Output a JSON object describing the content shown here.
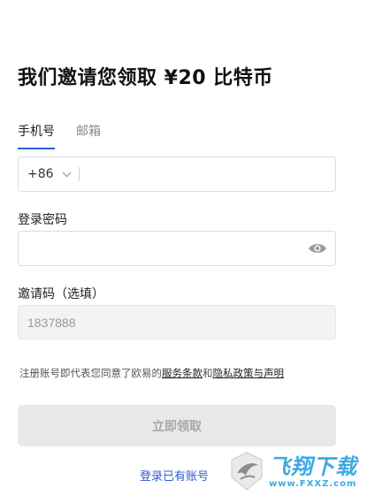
{
  "title": "我们邀请您领取 ¥20 比特币",
  "tabs": [
    {
      "label": "手机号",
      "active": true
    },
    {
      "label": "邮箱",
      "active": false
    }
  ],
  "phone": {
    "country_code": "+86",
    "value": "",
    "placeholder": ""
  },
  "password": {
    "label": "登录密码",
    "value": "",
    "placeholder": ""
  },
  "invite": {
    "label": "邀请码（选填）",
    "value": "1837888"
  },
  "terms": {
    "prefix": "注册账号即代表您同意了欧易的",
    "service_link": "服务条款",
    "and": "和",
    "privacy_link": "隐私政策与声明"
  },
  "submit_label": "立即领取",
  "login_link": "登录已有账号",
  "watermark": {
    "main": "飞翔下载",
    "url": "www.FXXZ.com"
  },
  "colors": {
    "accent": "#2d5bd3",
    "disabled_button": "#e8e8e8",
    "watermark": "#3da9e3"
  },
  "icons": {
    "dropdown": "chevron-down-icon",
    "visibility": "eye-icon"
  }
}
